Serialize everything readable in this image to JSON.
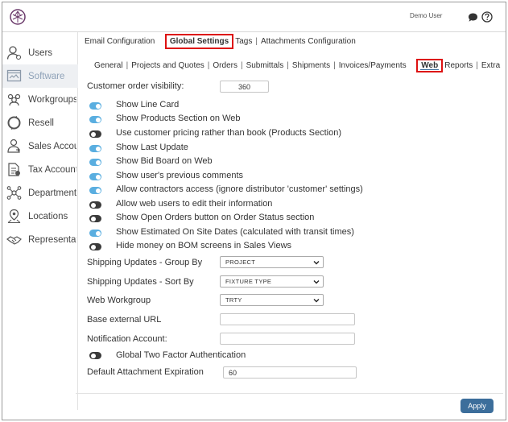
{
  "header": {
    "user": "Demo User",
    "logo_icon": "app-logo-icon",
    "chat_icon": "chat-icon",
    "help_icon": "help-icon"
  },
  "sidebar": {
    "items": [
      {
        "label": "Users",
        "icon": "user-icon",
        "active": false
      },
      {
        "label": "Software",
        "icon": "software-icon",
        "active": true
      },
      {
        "label": "Workgroups",
        "icon": "workgroups-icon",
        "active": false
      },
      {
        "label": "Resell",
        "icon": "resell-icon",
        "active": false
      },
      {
        "label": "Sales Accounts",
        "icon": "sales-accounts-icon",
        "active": false
      },
      {
        "label": "Tax Accounts",
        "icon": "tax-accounts-icon",
        "active": false
      },
      {
        "label": "Departments",
        "icon": "departments-icon",
        "active": false
      },
      {
        "label": "Locations",
        "icon": "locations-icon",
        "active": false
      },
      {
        "label": "Representatives",
        "icon": "representatives-icon",
        "active": false
      }
    ]
  },
  "tabs": [
    "Email Configuration",
    "Global Settings",
    "Tags",
    "Attachments Configuration"
  ],
  "subtabs": [
    "General",
    "Projects and Quotes",
    "Orders",
    "Submittals",
    "Shipments",
    "Invoices/Payments",
    "Web",
    "Reports",
    "Extra"
  ],
  "settings": {
    "visibility_label": "Customer order visibility:",
    "visibility_value": "360",
    "toggles": [
      {
        "label": "Show Line Card",
        "on": true
      },
      {
        "label": "Show Products Section on Web",
        "on": true
      },
      {
        "label": "Use customer pricing rather than book (Products Section)",
        "on": false
      },
      {
        "label": "Show Last Update",
        "on": true
      },
      {
        "label": "Show Bid Board on Web",
        "on": true
      },
      {
        "label": "Show user's previous comments",
        "on": true
      },
      {
        "label": "Allow contractors access (ignore distributor 'customer' settings)",
        "on": true
      },
      {
        "label": "Allow web users to edit their information",
        "on": false
      },
      {
        "label": "Show Open Orders button on Order Status section",
        "on": false
      },
      {
        "label": "Show Estimated On Site Dates (calculated with transit times)",
        "on": true
      },
      {
        "label": "Hide money on BOM screens in Sales Views",
        "on": false
      }
    ],
    "group_by_label": "Shipping Updates - Group By",
    "group_by_value": "PROJECT",
    "sort_by_label": "Shipping Updates - Sort By",
    "sort_by_value": "FIXTURE TYPE",
    "workgroup_label": "Web Workgroup",
    "workgroup_value": "TRTY",
    "base_url_label": "Base external URL",
    "base_url_value": "",
    "notification_label": "Notification Account:",
    "notification_value": "",
    "two_factor_label": "Global Two Factor Authentication",
    "two_factor_on": false,
    "expiration_label": "Default Attachment Expiration",
    "expiration_value": "60"
  },
  "apply_label": "Apply",
  "colors": {
    "accent": "#3c6e9b",
    "toggle_on": "#5aaee0",
    "toggle_off": "#3b3b3b",
    "highlight_box": "#dd1111"
  }
}
